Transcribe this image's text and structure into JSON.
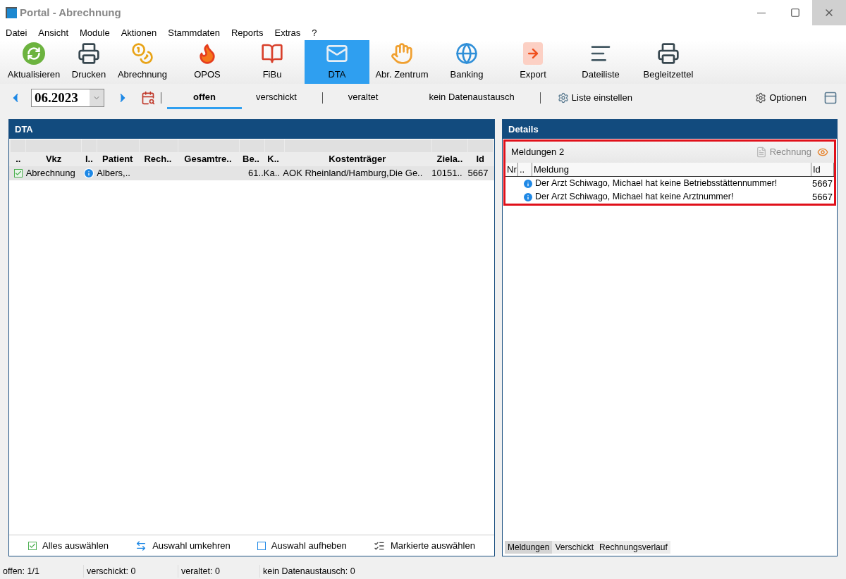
{
  "window": {
    "title": "Portal - Abrechnung"
  },
  "menu": [
    "Datei",
    "Ansicht",
    "Module",
    "Aktionen",
    "Stammdaten",
    "Reports",
    "Extras",
    "?"
  ],
  "toolbar": [
    {
      "label": "Aktualisieren",
      "kind": "refresh",
      "selected": false
    },
    {
      "label": "Drucken",
      "kind": "printer",
      "selected": false
    },
    {
      "label": "Abrechnung",
      "kind": "coins",
      "selected": false
    },
    {
      "label": "OPOS",
      "kind": "flame",
      "selected": false
    },
    {
      "label": "FiBu",
      "kind": "books",
      "selected": false
    },
    {
      "label": "DTA",
      "kind": "mail",
      "selected": true
    },
    {
      "label": "Abr. Zentrum",
      "kind": "hand",
      "selected": false
    },
    {
      "label": "Banking",
      "kind": "globe",
      "selected": false
    },
    {
      "label": "Export",
      "kind": "export",
      "selected": false
    },
    {
      "label": "Dateiliste",
      "kind": "list",
      "selected": false
    },
    {
      "label": "Begleitzettel",
      "kind": "printer",
      "selected": false
    }
  ],
  "period": {
    "value": "06.2023"
  },
  "filters": [
    {
      "label": "offen",
      "selected": true
    },
    {
      "label": "verschickt",
      "selected": false
    },
    {
      "label": "veraltet",
      "selected": false
    },
    {
      "label": "kein Datenaustausch",
      "selected": false
    }
  ],
  "list_settings": "Liste einstellen",
  "options": "Optionen",
  "dta": {
    "title": "DTA",
    "columns": [
      "..",
      "Vkz",
      "I..",
      "Patient",
      "Rech..",
      "Gesamtre..",
      "Be..",
      "K..",
      "Kostenträger",
      "Ziela..",
      "Id"
    ],
    "rows": [
      {
        "checked": true,
        "selected": true,
        "info": true,
        "cells": [
          "",
          "Abrechnung",
          "",
          "Albers,..",
          "",
          "",
          "61..",
          "Ka..",
          "AOK Rheinland/Hamburg,Die Ge..",
          "10151..",
          "5667"
        ]
      }
    ],
    "actions": [
      {
        "label": "Alles auswählen",
        "kind": "check"
      },
      {
        "label": "Auswahl umkehren",
        "kind": "swap"
      },
      {
        "label": "Auswahl aufheben",
        "kind": "square"
      },
      {
        "label": "Markierte auswählen",
        "kind": "marked"
      }
    ]
  },
  "details": {
    "title": "Details",
    "highlighted": true,
    "messages_title": "Meldungen 2",
    "invoice_button": "Rechnung",
    "columns": [
      "Nr",
      "..",
      "Meldung",
      "Id"
    ],
    "messages": [
      {
        "text": "Der Arzt Schiwago, Michael hat keine Betriebsstättennummer!",
        "id": "5667"
      },
      {
        "text": "Der Arzt Schiwago, Michael hat keine Arztnummer!",
        "id": "5667"
      }
    ],
    "tabs": [
      {
        "label": "Meldungen",
        "selected": true
      },
      {
        "label": "Verschickt",
        "selected": false
      },
      {
        "label": "Rechnungsverlauf",
        "selected": false
      }
    ]
  },
  "status_bar": [
    "offen: 1/1",
    "verschickt: 0",
    "veraltet: 0",
    "kein Datenaustausch: 0"
  ]
}
